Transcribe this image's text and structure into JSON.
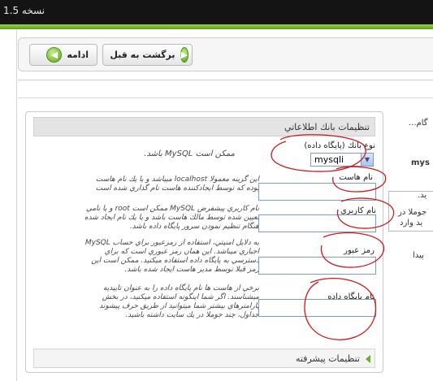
{
  "header": {
    "version": "نسخه 1.5"
  },
  "toolbar": {
    "next_label": "ادامه",
    "back_label": "برگشت به قبل"
  },
  "panel": {
    "title": "تنظیمات بانك اطلاعاتي",
    "db_type": {
      "label": "نوع بانك (پايگاه داده)",
      "help": "ممكن است MySQL باشد.",
      "selected": "mysqli"
    },
    "host": {
      "label": "نام هاست",
      "help_lines": [
        "اين گزينه معمولا localhost ميباشد و يا يك نام هاست",
        "بوده كه توسط ايجادكننده هاست نام گذاري شده است"
      ],
      "value": ""
    },
    "username": {
      "label": "نام كاربري",
      "help_lines": [
        "نام كاربري پيشفرض MySQL ممكن است root و يا نامي",
        "تعيين شده توسط مالك هاست باشد و يا يك نام ايجاد شده",
        "هنگام تنظيم نمودن سرور پايگاه داده باشد."
      ],
      "value": ""
    },
    "password": {
      "label": "رمز عبور",
      "help_lines": [
        "به دلايل امنيتي، استفاده از رمزعبور براي حساب MySQL",
        "اجباري ميباشد. اين همان رمز عبوري است كه براي",
        "دسترسي به پايگاه داده استفاده ميكنيد. ممكن است اين",
        "رمز قبلا توسط مدير هاست ايجاد شده باشد."
      ],
      "value": ""
    },
    "db_name": {
      "label": "نام پايگاه داده",
      "help_lines": [
        "برخي از هاست ها نام پايگاه داده را به عنوان تاييديه",
        "ميشناسند. اگر شما اينگونه استفاده ميكنيد، در بخش",
        "پارامترهاي بيشتر شما ميتوانيد از طريق حرف پيشوند",
        "جداول، چند جوملا در يك سايت داشته باشيد."
      ],
      "value": ""
    },
    "advanced": {
      "label": "تنظیمات پيشرفته"
    }
  },
  "right_side": {
    "line1": "گام...",
    "line2": "mys",
    "line3": "يد.",
    "line4": "جوملا در",
    "line5": "يد وارد",
    "line6": "پيدا"
  },
  "colors": {
    "annotation": "#cc1a1a",
    "accent_green": "#6aab2a"
  }
}
